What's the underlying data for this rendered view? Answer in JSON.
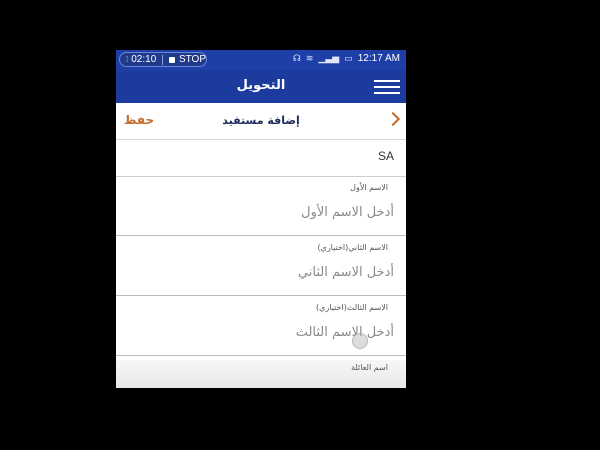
{
  "status_bar": {
    "rec_time": "02:10",
    "stop_label": "STOP",
    "clock": "12:17 AM",
    "icons": [
      "headset-icon",
      "wifi-icon",
      "signal-icon",
      "battery-icon"
    ]
  },
  "app_bar": {
    "title": "التحويل"
  },
  "sub_header": {
    "save_label": "حفظ",
    "title": "إضافة مستفيد"
  },
  "country_row": {
    "value": "SA"
  },
  "fields": [
    {
      "label": "الاسم الأول",
      "placeholder": "أدخل الاسم الأول"
    },
    {
      "label": "الاسم الثاني(اختياري)",
      "placeholder": "أدخل الاسم الثاني"
    },
    {
      "label": "الاسم الثالث(اختياري)",
      "placeholder": "أدخل الاسم الثالث"
    },
    {
      "label": "اسم العائلة",
      "placeholder": ""
    }
  ],
  "colors": {
    "primary": "#1c3b9e",
    "accent": "#c46a2b"
  }
}
